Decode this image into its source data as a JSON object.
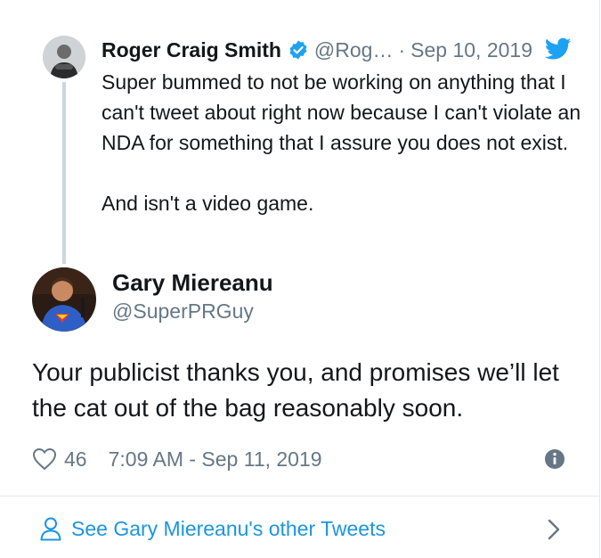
{
  "parent_tweet": {
    "author_name": "Roger Craig Smith",
    "handle": "@Rog…",
    "separator": "·",
    "date": "Sep 10, 2019",
    "text": "Super bummed to not be working on anything that I can't tweet about right now because I can't violate an NDA for something that I assure you does not exist.\n\nAnd isn't a video game.",
    "verified_icon": "verified-badge-icon",
    "brand_icon": "twitter-bird-icon"
  },
  "main_tweet": {
    "author_name": "Gary Miereanu",
    "handle": "@SuperPRGuy",
    "text": "Your publicist thanks you, and promises we’ll let the cat out of the bag reasonably soon.",
    "like_count": "46",
    "timestamp": "7:09 AM - Sep 11, 2019",
    "like_icon": "heart-icon",
    "info_icon": "info-icon"
  },
  "footer": {
    "link_label": "See Gary Miereanu's other Tweets",
    "user_icon": "user-icon",
    "chevron_icon": "chevron-right-icon"
  },
  "colors": {
    "link_blue": "#1b95e0",
    "muted_gray": "#657786",
    "text_dark": "#14171a",
    "divider": "#e1e8ed"
  }
}
